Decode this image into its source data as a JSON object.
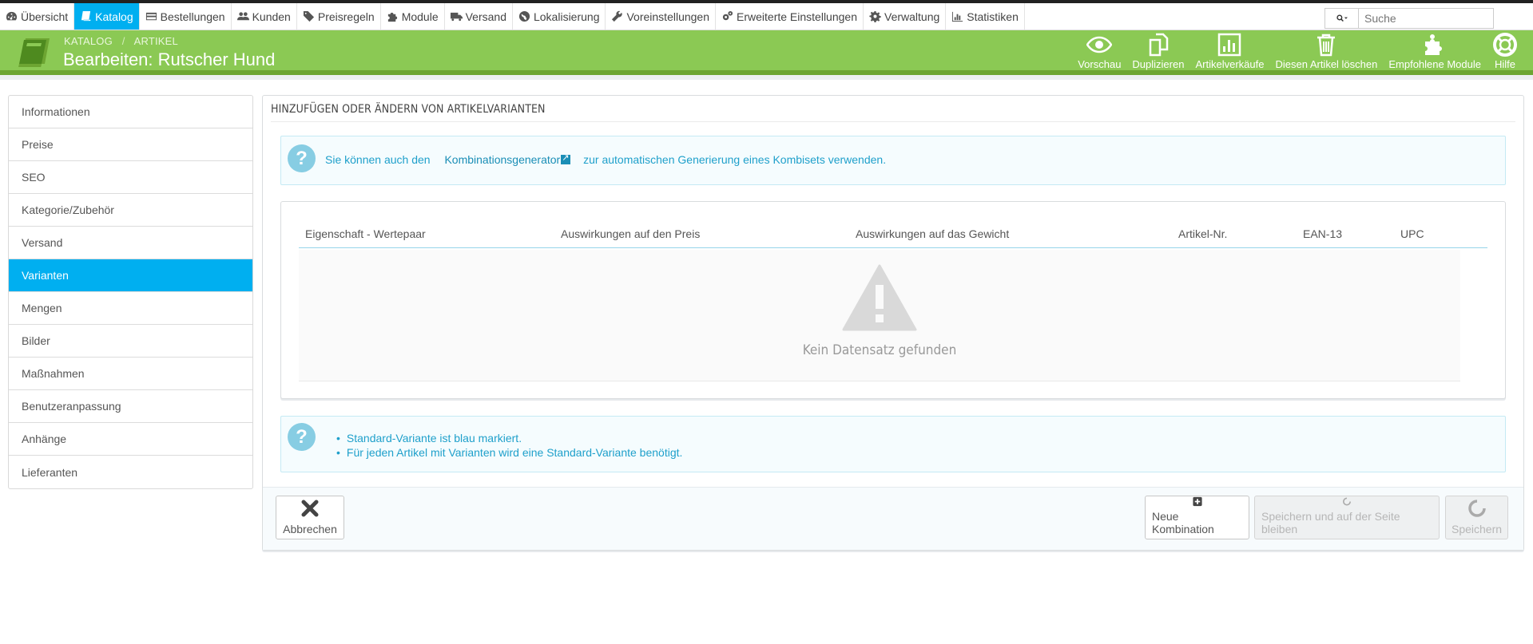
{
  "topnav": {
    "items": [
      {
        "label": "Übersicht",
        "icon": "dashboard-icon"
      },
      {
        "label": "Katalog",
        "icon": "book-icon",
        "active": true
      },
      {
        "label": "Bestellungen",
        "icon": "credit-card-icon"
      },
      {
        "label": "Kunden",
        "icon": "users-icon"
      },
      {
        "label": "Preisregeln",
        "icon": "tags-icon"
      },
      {
        "label": "Module",
        "icon": "puzzle-icon"
      },
      {
        "label": "Versand",
        "icon": "truck-icon"
      },
      {
        "label": "Lokalisierung",
        "icon": "globe-icon"
      },
      {
        "label": "Voreinstellungen",
        "icon": "wrench-icon"
      },
      {
        "label": "Erweiterte Einstellungen",
        "icon": "cogs-icon"
      },
      {
        "label": "Verwaltung",
        "icon": "gear-icon"
      },
      {
        "label": "Statistiken",
        "icon": "bar-chart-icon"
      }
    ],
    "search_placeholder": "Suche"
  },
  "header": {
    "breadcrumb": [
      "Katalog",
      "Artikel"
    ],
    "title": "Bearbeiten: Rutscher Hund",
    "toolbar": [
      {
        "label": "Vorschau",
        "icon": "eye-icon"
      },
      {
        "label": "Duplizieren",
        "icon": "copy-icon"
      },
      {
        "label": "Artikelverkäufe",
        "icon": "bar-chart-icon"
      },
      {
        "label": "Diesen Artikel löschen",
        "icon": "trash-icon"
      },
      {
        "label": "Empfohlene Module",
        "icon": "puzzle-icon"
      },
      {
        "label": "Hilfe",
        "icon": "lifebuoy-icon"
      }
    ],
    "colors": {
      "green": "#8bc954",
      "active_blue": "#00aff0"
    }
  },
  "sidebar": {
    "items": [
      "Informationen",
      "Preise",
      "SEO",
      "Kategorie/Zubehör",
      "Versand",
      "Varianten",
      "Mengen",
      "Bilder",
      "Maßnahmen",
      "Benutzeranpassung",
      "Anhänge",
      "Lieferanten"
    ],
    "active": "Varianten"
  },
  "panel": {
    "title": "Hinzufügen oder Ändern von Artikelvarianten",
    "alert_top": {
      "before": "Sie können auch den",
      "link": "Kombinationsgenerator",
      "after": "zur automatischen Generierung eines Kombisets verwenden."
    },
    "table": {
      "columns": [
        "Eigenschaft - Wertepaar",
        "Auswirkungen auf den Preis",
        "Auswirkungen auf das Gewicht",
        "Artikel-Nr.",
        "EAN-13",
        "UPC"
      ],
      "empty_text": "Kein Datensatz gefunden"
    },
    "alert_bottom": [
      "Standard-Variante ist blau markiert.",
      "Für jeden Artikel mit Varianten wird eine Standard-Variante benötigt."
    ],
    "footer": {
      "cancel": "Abbrechen",
      "new_combination": "Neue Kombination",
      "save_stay": "Speichern und auf der Seite bleiben",
      "save": "Speichern"
    }
  }
}
